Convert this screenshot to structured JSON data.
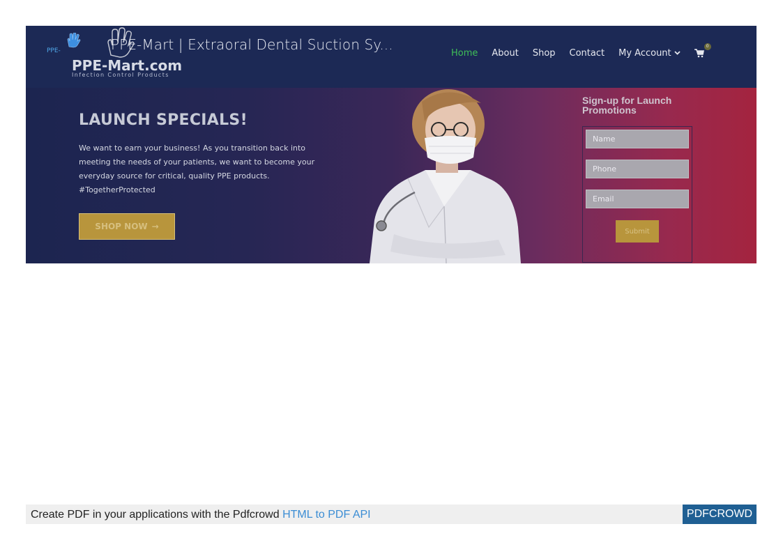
{
  "header": {
    "doc_title": "PPE-Mart | Extraoral Dental Suction Sy...",
    "logo_small_text": "PPE-",
    "brand": "PPE-Mart.com",
    "brand_tagline": "Infection Control Products",
    "nav": [
      {
        "label": "Home",
        "active": true
      },
      {
        "label": "About"
      },
      {
        "label": "Shop"
      },
      {
        "label": "Contact"
      },
      {
        "label": "My Account"
      }
    ],
    "cart_count": "0",
    "icons": [
      "hand-icon",
      "chevron-down-icon",
      "cart-icon"
    ]
  },
  "hero": {
    "title": "LAUNCH SPECIALS!",
    "text": "We want to earn your business! As you transition back into meeting the needs of your patients, we want to become your everyday source for critical, quality PPE products. #TogetherProtected",
    "shop_button": "SHOP NOW",
    "shop_arrow": "→"
  },
  "signup": {
    "title": "Sign-up for Launch Promotions",
    "name_placeholder": "Name",
    "phone_placeholder": "Phone",
    "email_placeholder": "Email",
    "submit": "Submit"
  },
  "pdf_bar": {
    "text": "Create PDF in your applications with the Pdfcrowd",
    "link": "HTML to PDF API",
    "badge": "PDFCROWD"
  },
  "colors": {
    "header_bg": "#1c2955",
    "nav_active": "#3fbf57",
    "button_gold": "#b8953c",
    "gradient_left": "#1c2550",
    "gradient_right": "#a4243f",
    "pdf_badge": "#1f5f93",
    "pdf_link": "#3b8dd4"
  }
}
